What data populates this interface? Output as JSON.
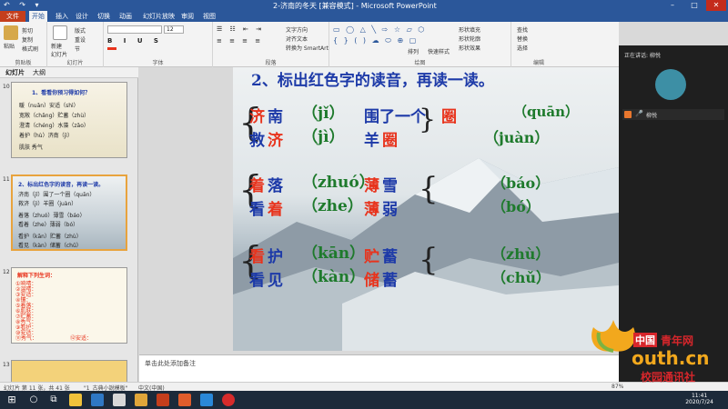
{
  "window": {
    "title": "2-济南的冬天 [兼容模式] - Microsoft PowerPoint",
    "quick_access": "↶ ↷ ▾"
  },
  "ribbon_tabs": [
    "文件",
    "开始",
    "插入",
    "设计",
    "切换",
    "动画",
    "幻灯片放映",
    "审阅",
    "视图"
  ],
  "ribbon": {
    "clipboard": {
      "paste": "粘贴",
      "cut": "剪切",
      "copy": "复制",
      "format_painter": "格式刷",
      "label": "剪贴板"
    },
    "slides": {
      "new_slide": "新建\n幻灯片",
      "layout": "版式",
      "reset": "重设",
      "section": "节",
      "label": "幻灯片"
    },
    "font": {
      "size": "12",
      "label": "字体"
    },
    "paragraph": {
      "text_direction": "文字方向",
      "align_text": "对齐文本",
      "smartart": "转换为 SmartArt",
      "label": "段落"
    },
    "drawing": {
      "arrange": "排列",
      "quick_styles": "快速样式",
      "shape_fill": "形状填充",
      "shape_outline": "形状轮廓",
      "shape_effects": "形状效果",
      "label": "绘图"
    },
    "editing": {
      "find": "查找",
      "replace": "替换",
      "select": "选择",
      "label": "编辑"
    }
  },
  "left_panel": {
    "tabs": [
      "幻灯片",
      "大纲"
    ],
    "thumbnails": [
      {
        "number": "10",
        "title": "1、看看你预习得如何？",
        "lines": [
          "暖（nuǎn）安适（shì）",
          "宽敞（chǎng）贮蓄（zhù）",
          "澄清（chéng）水藻（zǎo）",
          "着护（hù）济南（jì）",
          "肌肤      秀气"
        ]
      },
      {
        "number": "11",
        "title": "2、标出红色字的读音，再读一读。",
        "lines": [
          "济南（jǐ）围了一个圈（quān）",
          "救济（jì）羊圈（juàn）",
          "着落（zhuó）薄雪（báo）",
          "看着（zhe）薄弱（bó）",
          "看护（kān）贮蓄（zhù）",
          "看见（kàn）储蓄（chǔ）"
        ]
      },
      {
        "number": "12",
        "title": "解释下列生词：",
        "lines": [
          "①响晴：",
          "②温晴：",
          "③安适：",
          "④镶：",
          "⑤着落：",
          "⑥肌肤：",
          "⑦贮蓄：",
          "⑧秀气：",
          "⑨看护：",
          "⑩安适：",
          "⑪秀气：",
          "⑫安适："
        ]
      },
      {
        "number": "13",
        "title": "",
        "lines": []
      }
    ]
  },
  "slide": {
    "heading": "2、标出红色字的读音，再读一读。",
    "rows": [
      {
        "a1": "济",
        "a2": "南",
        "p1": "（jǐ）",
        "b1": "围了一个",
        "b2": "圈",
        "p2": "（quān）"
      },
      {
        "a1": "救",
        "a2": "济",
        "p1": "（jì）",
        "b1": "羊",
        "b2": "圈",
        "p2": "（juàn）"
      },
      {
        "a1": "着",
        "a2": "落",
        "p1": "（zhuó）",
        "b1": "薄",
        "b2": "雪",
        "p2": "（báo）"
      },
      {
        "a1": "看",
        "a2": "着",
        "p1": "（zhe）",
        "b1": "薄",
        "b2": "弱",
        "p2": "（bó）"
      },
      {
        "a1": "看",
        "a2": "护",
        "p1": "（kān）",
        "b1": "贮",
        "b2": "蓄",
        "p2": "（zhù）"
      },
      {
        "a1": "看",
        "a2": "见",
        "p1": "（kàn）",
        "b1": "储",
        "b2": "蓄",
        "p2": "（chǔ）"
      }
    ]
  },
  "notes": {
    "placeholder": "单击此处添加备注"
  },
  "call_panel": {
    "speaking": "正在讲话: 柳悦",
    "name": "柳悦"
  },
  "status_bar": {
    "slide_info": "幻灯片 第 11 张，共 41 张",
    "theme": "\"1_古典小說模板\"",
    "language": "中文(中国)",
    "zoom": "87%"
  },
  "taskbar": {
    "time": "11:41",
    "date": "2020/7/24"
  },
  "watermark": {
    "line1": "中国",
    "line2": "青年网",
    "line3": "outh.cn",
    "line4": "校园通讯社"
  },
  "colors": {
    "accent": "#2b579a",
    "file_tab": "#c43e1c",
    "red_char": "#e8331c",
    "blue_char": "#1d3aa8",
    "pinyin": "#1e7a2c",
    "selection": "#e8a33d"
  }
}
